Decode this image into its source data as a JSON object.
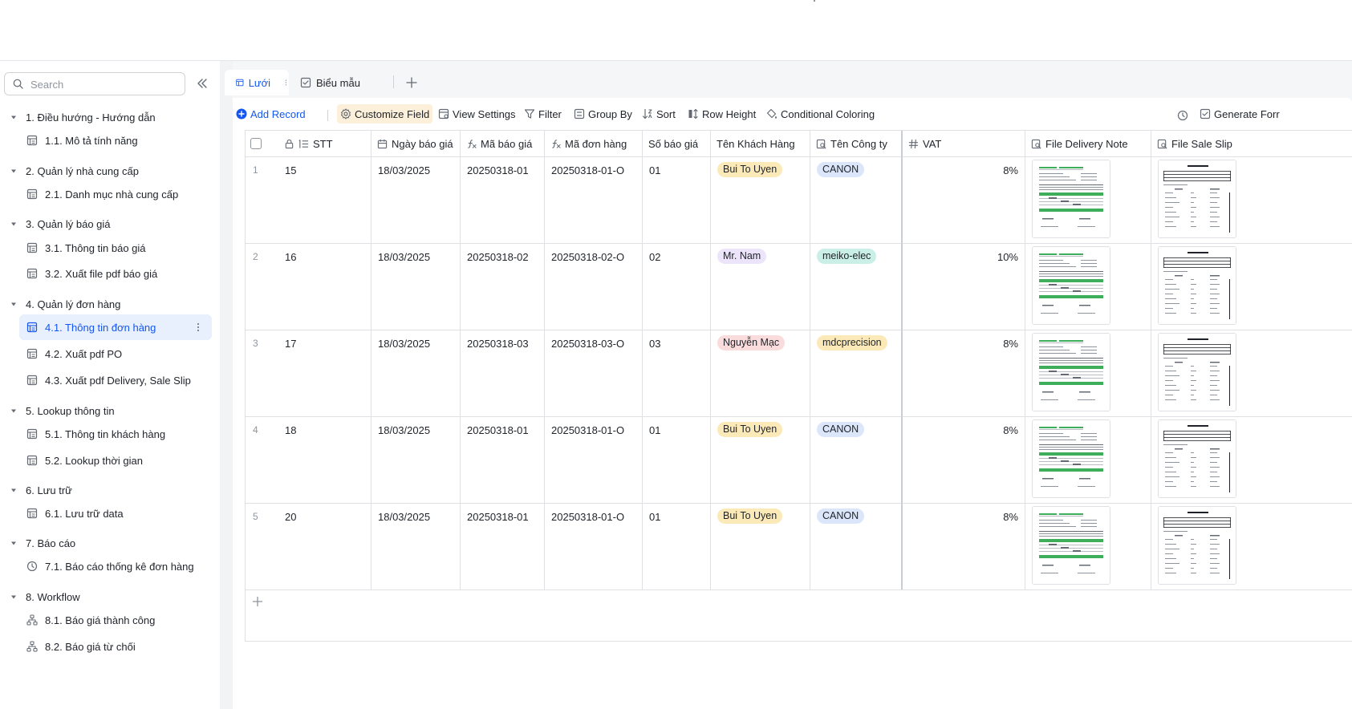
{
  "search": {
    "placeholder": "Search"
  },
  "sidebar": {
    "groups": [
      {
        "label": "1. Điều hướng - Hướng dẫn",
        "items": [
          {
            "label": "1.1. Mô tả tính năng",
            "icon": "table-icon"
          }
        ]
      },
      {
        "label": "2. Quản lý nhà cung cấp",
        "items": [
          {
            "label": "2.1. Danh mục nhà cung cấp",
            "icon": "table-icon"
          }
        ]
      },
      {
        "label": "3. Quản lý báo giá",
        "items": [
          {
            "label": "3.1. Thông tin báo giá",
            "icon": "table-icon"
          },
          {
            "label": "3.2. Xuất file pdf báo giá",
            "icon": "table-icon"
          }
        ]
      },
      {
        "label": "4. Quản lý đơn hàng",
        "items": [
          {
            "label": "4.1. Thông tin đơn hàng",
            "icon": "table-icon",
            "active": true
          },
          {
            "label": "4.2. Xuất pdf PO",
            "icon": "table-icon"
          },
          {
            "label": "4.3. Xuất pdf Delivery, Sale Slip",
            "icon": "table-icon"
          }
        ]
      },
      {
        "label": "5. Lookup thông tin",
        "items": [
          {
            "label": "5.1. Thông tin khách hàng",
            "icon": "table-icon"
          },
          {
            "label": "5.2. Lookup thời gian",
            "icon": "table-icon"
          }
        ]
      },
      {
        "label": "6. Lưu trữ",
        "items": [
          {
            "label": "6.1. Lưu trữ data",
            "icon": "table-icon"
          }
        ]
      },
      {
        "label": "7. Báo cáo",
        "items": [
          {
            "label": "7.1. Báo cáo thống kê đơn hàng",
            "icon": "dashboard-icon"
          }
        ]
      },
      {
        "label": "8. Workflow",
        "items": [
          {
            "label": "8.1. Báo giá thành công",
            "icon": "workflow-icon"
          },
          {
            "label": "8.2. Báo giá từ chối",
            "icon": "workflow-icon"
          }
        ]
      }
    ]
  },
  "tabs": [
    {
      "label": "Lưới",
      "icon": "grid-view-icon",
      "active": true
    },
    {
      "label": "Biểu mẫu",
      "icon": "form-view-icon",
      "active": false
    }
  ],
  "toolbar": {
    "add_record": "Add Record",
    "customize_field": "Customize Field",
    "view_settings": "View Settings",
    "filter": "Filter",
    "group_by": "Group By",
    "sort": "Sort",
    "row_height": "Row Height",
    "conditional_coloring": "Conditional Coloring",
    "generate_form": "Generate Forr"
  },
  "columns": [
    {
      "label": "STT",
      "icon": "number-sequence-icon"
    },
    {
      "label": "Ngày báo giá",
      "icon": "date-icon"
    },
    {
      "label": "Mã báo giá",
      "icon": "formula-icon"
    },
    {
      "label": "Mã đơn hàng",
      "icon": "formula-icon"
    },
    {
      "label": "Số báo giá",
      "icon": ""
    },
    {
      "label": "Tên Khách Hàng",
      "icon": ""
    },
    {
      "label": "Tên Công ty",
      "icon": "lookup-icon"
    },
    {
      "label": "VAT",
      "icon": "hash-icon"
    },
    {
      "label": "File Delivery Note",
      "icon": "lookup-icon"
    },
    {
      "label": "File Sale Slip",
      "icon": "lookup-icon"
    }
  ],
  "rows": [
    {
      "num": "1",
      "stt": "15",
      "date": "18/03/2025",
      "ma_bao_gia": "20250318-01",
      "ma_don_hang": "20250318-01-O",
      "so_bao_gia": "01",
      "khach_hang": "Bui To Uyen",
      "kh_color": "#fbe9b7",
      "cong_ty": "CANON",
      "ct_color": "#dbe6fa",
      "vat": "8%"
    },
    {
      "num": "2",
      "stt": "16",
      "date": "18/03/2025",
      "ma_bao_gia": "20250318-02",
      "ma_don_hang": "20250318-02-O",
      "so_bao_gia": "02",
      "khach_hang": "Mr. Nam",
      "kh_color": "#ece4fb",
      "cong_ty": "meiko-elec",
      "ct_color": "#c9efe6",
      "vat": "10%"
    },
    {
      "num": "3",
      "stt": "17",
      "date": "18/03/2025",
      "ma_bao_gia": "20250318-03",
      "ma_don_hang": "20250318-03-O",
      "so_bao_gia": "03",
      "khach_hang": "Nguyễn Mạc",
      "kh_color": "#fadcdc",
      "cong_ty": "mdcprecision",
      "ct_color": "#fbe9b7",
      "vat": "8%"
    },
    {
      "num": "4",
      "stt": "18",
      "date": "18/03/2025",
      "ma_bao_gia": "20250318-01",
      "ma_don_hang": "20250318-01-O",
      "so_bao_gia": "01",
      "khach_hang": "Bui To Uyen",
      "kh_color": "#fbe9b7",
      "cong_ty": "CANON",
      "ct_color": "#dbe6fa",
      "vat": "8%"
    },
    {
      "num": "5",
      "stt": "20",
      "date": "18/03/2025",
      "ma_bao_gia": "20250318-01",
      "ma_don_hang": "20250318-01-O",
      "so_bao_gia": "01",
      "khach_hang": "Bui To Uyen",
      "kh_color": "#fbe9b7",
      "cong_ty": "CANON",
      "ct_color": "#dbe6fa",
      "vat": "8%"
    }
  ],
  "colors": {
    "accent": "#1456f0",
    "active_bg": "#e8effd",
    "highlight_bg": "#fcf0da",
    "border": "#dee0e3"
  }
}
